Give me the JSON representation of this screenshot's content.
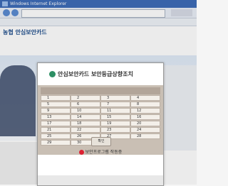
{
  "window": {
    "title": "Windows Internet Explorer"
  },
  "site": {
    "logo": "농협 안심보안카드",
    "logo_sub": "",
    "nav": [
      "",
      "",
      "",
      "",
      "",
      ""
    ]
  },
  "dialog": {
    "title": "안심보안카드 보안등급상향조치",
    "instruction": "",
    "card_number": "",
    "cells": [
      "1",
      "2",
      "3",
      "4",
      "5",
      "6",
      "7",
      "8",
      "9",
      "10",
      "11",
      "12",
      "13",
      "14",
      "15",
      "16",
      "17",
      "18",
      "19",
      "20",
      "21",
      "22",
      "23",
      "24",
      "25",
      "26",
      "27",
      "28",
      "29",
      "30"
    ],
    "ok_label": "확인",
    "footer": "보안프로그램 작동중",
    "bottom_text": ""
  }
}
